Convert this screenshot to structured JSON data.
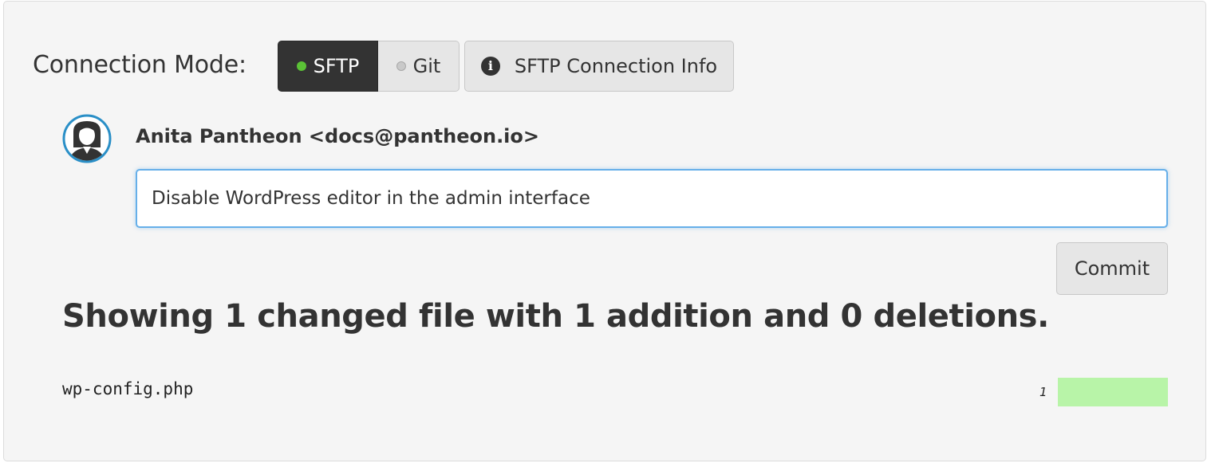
{
  "connection": {
    "label": "Connection Mode:",
    "modes": [
      {
        "label": "SFTP",
        "active": true,
        "indicator_color": "#5bc236"
      },
      {
        "label": "Git",
        "active": false,
        "indicator_color": "#c9c9c9"
      }
    ],
    "info_button": {
      "label": "SFTP Connection Info",
      "icon": "info-circle-icon"
    }
  },
  "commit": {
    "author": "Anita Pantheon <docs@pantheon.io>",
    "avatar_icon": "user-avatar-icon",
    "message_value": "Disable WordPress editor in the admin interface",
    "button_label": "Commit"
  },
  "diff": {
    "summary": "Showing 1 changed file with 1 addition and 0 deletions.",
    "files": [
      {
        "name": "wp-config.php",
        "additions": "1",
        "addition_color": "#b8f4a8"
      }
    ]
  },
  "colors": {
    "active_mode_bg": "#333333",
    "focus_border": "#66afe9",
    "panel_bg": "#f5f5f5"
  }
}
